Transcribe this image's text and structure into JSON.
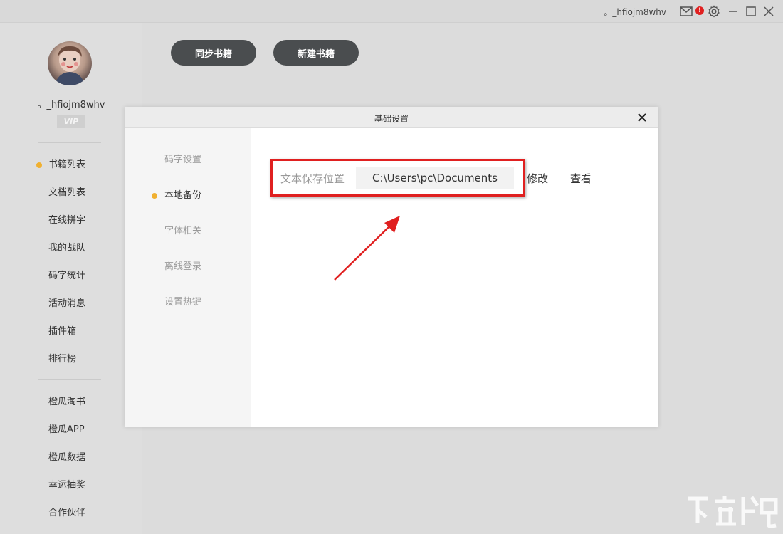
{
  "titlebar": {
    "username": "。_hfiojm8whv",
    "badge": "!",
    "icons": [
      "mail-icon",
      "alert-icon",
      "gear-icon",
      "minimize-icon",
      "maximize-icon",
      "close-icon"
    ]
  },
  "sidebar": {
    "username": "。_hfiojm8whv",
    "vip": "VIP",
    "items": [
      {
        "label": "书籍列表",
        "active": true
      },
      {
        "label": "文档列表"
      },
      {
        "label": "在线拼字"
      },
      {
        "label": "我的战队"
      },
      {
        "label": "码字统计"
      },
      {
        "label": "活动消息"
      },
      {
        "label": "插件箱"
      },
      {
        "label": "排行榜"
      }
    ],
    "extra_items": [
      {
        "label": "橙瓜淘书"
      },
      {
        "label": "橙瓜APP"
      },
      {
        "label": "橙瓜数据"
      },
      {
        "label": "幸运抽奖"
      },
      {
        "label": "合作伙伴"
      }
    ]
  },
  "toolbar": {
    "sync_label": "同步书籍",
    "new_label": "新建书籍"
  },
  "dialog": {
    "title": "基础设置",
    "menu": [
      {
        "label": "码字设置"
      },
      {
        "label": "本地备份",
        "active": true
      },
      {
        "label": "字体相关"
      },
      {
        "label": "离线登录"
      },
      {
        "label": "设置热键"
      }
    ],
    "save_label": "文本保存位置",
    "save_path": "C:\\Users\\pc\\Documents",
    "modify_label": "修改",
    "view_label": "查看"
  },
  "colors": {
    "accent_dot": "#f0b030",
    "button_dark": "#4a4d4f",
    "highlight": "#e02020"
  }
}
